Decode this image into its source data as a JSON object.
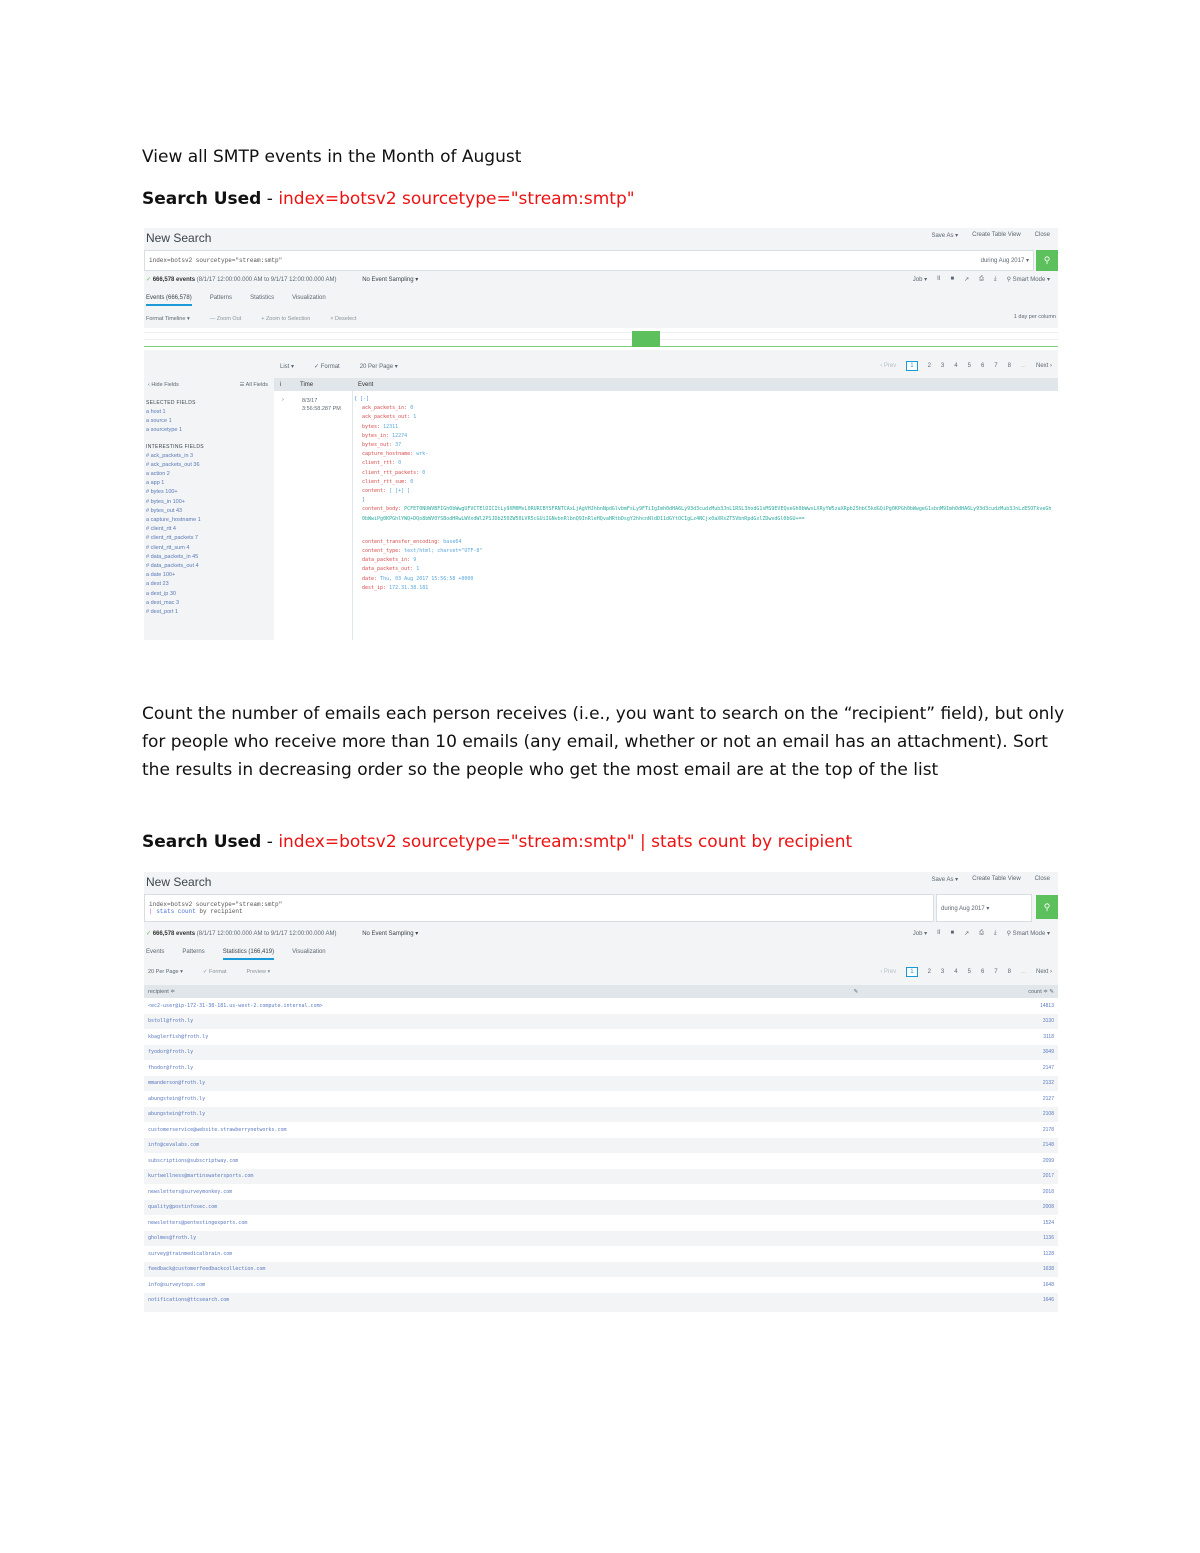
{
  "doc": {
    "heading1": "View all SMTP events in the Month of August",
    "search_label": "Search Used",
    "search_dash": " - ",
    "search1": "index=botsv2 sourcetype=\"stream:smtp\"",
    "paragraph2": "Count the number of emails each person receives (i.e., you want to search on the “recipient” field), but only for people who receive more than 10 emails (any email, whether or not an email has an attachment). Sort the results in decreasing order so the people who get the most email are at the top of the list",
    "search2": "index=botsv2 sourcetype=\"stream:smtp\" | stats count by recipient"
  },
  "panel1": {
    "title": "New Search",
    "actions": [
      "Save As ▾",
      "Create Table View",
      "Close"
    ],
    "query": "index=botsv2 sourcetype=\"stream:smtp\"",
    "time_picker": "during Aug 2017 ▾",
    "search_icon": "⚲",
    "status_check": "✓",
    "status_count": "666,578 events",
    "status_range": "(8/1/17 12:00:00.000 AM to 9/1/17 12:00:00.000 AM)",
    "sampling": "No Event Sampling ▾",
    "jobtools": [
      "Job ▾",
      "II",
      "■",
      "↗",
      "⎙",
      "⤓",
      "⚲ Smart Mode ▾"
    ],
    "tabs": [
      "Events (666,578)",
      "Patterns",
      "Statistics",
      "Visualization"
    ],
    "subtools": [
      "Format Timeline ▾",
      "— Zoom Out",
      "+ Zoom to Selection",
      "× Deselect"
    ],
    "timeline_scale": "1 day per column",
    "timeline_bar_values": [
      0,
      0,
      0,
      0,
      0,
      0,
      0,
      0,
      0,
      0,
      0,
      1,
      0,
      0,
      0,
      0,
      0,
      0,
      0,
      0,
      0,
      0
    ],
    "listtools": [
      "List ▾",
      "✓ Format",
      "20 Per Page ▾"
    ],
    "pager": {
      "prev": "‹ Prev",
      "pages": [
        "1",
        "2",
        "3",
        "4",
        "5",
        "6",
        "7",
        "8"
      ],
      "ellipsis": "...",
      "next": "Next ›"
    },
    "fields_sidebar": {
      "hide": "‹ Hide Fields",
      "all": "☰ All Fields",
      "selected_title": "SELECTED FIELDS",
      "selected": [
        "a host 1",
        "a source 1",
        "a sourcetype 1"
      ],
      "interesting_title": "INTERESTING FIELDS",
      "interesting": [
        "# ack_packets_in 3",
        "# ack_packets_out 36",
        "a action 2",
        "a app 1",
        "# bytes 100+",
        "# bytes_in 100+",
        "# bytes_out 43",
        "a capture_hostname 1",
        "# client_rtt 4",
        "# client_rtt_packets 7",
        "# client_rtt_sum 4",
        "# data_packets_in 45",
        "# data_packets_out 4",
        "a date 100+",
        "a dest 23",
        "a dest_ip 30",
        "a dest_mac 3",
        "# dest_port 1"
      ]
    },
    "events_header": {
      "i": "i",
      "time": "Time",
      "event": "Event"
    },
    "event": {
      "expand": "›",
      "time": [
        "8/3/17",
        "3:56:58.287 PM"
      ],
      "open": "{ [-]",
      "fields": [
        {
          "k": "ack_packets_in",
          "v": "0"
        },
        {
          "k": "ack_packets_out",
          "v": "1"
        },
        {
          "k": "bytes",
          "v": "12311"
        },
        {
          "k": "bytes_in",
          "v": "12274"
        },
        {
          "k": "bytes_out",
          "v": "37"
        },
        {
          "k": "capture_hostname",
          "v": "wrk-"
        },
        {
          "k": "client_rtt",
          "v": "0"
        },
        {
          "k": "client_rtt_packets",
          "v": "0"
        },
        {
          "k": "client_rtt_sum",
          "v": "0"
        },
        {
          "k": "content",
          "v": "[ [+] ]"
        }
      ],
      "close_mark": "]",
      "body_key": "content_body",
      "body_blob": "PCFET0NUWVBFIGh0bWwgUFVCTElDICItLy9XM0MvL0RURCBYSFRNTCAxLjAgVHJhbnNpdGlvbmFsLy9FTiIgImh0dHA6Ly93d3cudzMub3JnL1RSL3hodG1sMS9EVEQveGh0bWwxLXRyYW5zaXRpb25hbC5kdGQiPg0KPGh0bWwgeG1sbnM9Imh0dHA6Ly93d3cudzMub3JnLzE5OTkveGh0bWwiPg0KPGhlYWQ+DQo8bWV0YSBodHRwLWVxdWl2PSJDb250ZW50LVR5cGUiIGNvbnRlbnQ9InRleHQvaHRtbDsgY2hhcnNldD11dGYtOCIgLz4NCjx0aXRsZT5VbnRpdGxlZDwvdGl0bGU+==",
      "fields2": [
        {
          "k": "content_transfer_encoding",
          "v": "base64"
        },
        {
          "k": "content_type",
          "v": "text/html; charset=\"UTF-8\""
        },
        {
          "k": "data_packets_in",
          "v": "9"
        },
        {
          "k": "data_packets_out",
          "v": "1"
        },
        {
          "k": "date",
          "v": "Thu, 03 Aug 2017 15:56:58 +0000"
        },
        {
          "k": "dest_ip",
          "v": "172.31.38.181"
        }
      ]
    }
  },
  "panel2": {
    "title": "New Search",
    "actions": [
      "Save As ▾",
      "Create Table View",
      "Close"
    ],
    "query_line1": "index=botsv2 sourcetype=\"stream:smtp\"",
    "query_pipe": "| ",
    "query_cmd": "stats count",
    "query_rest": " by recipient",
    "time_picker": "during Aug 2017 ▾",
    "search_icon": "⚲",
    "status_check": "✓",
    "status_count": "666,578 events",
    "status_range": "(8/1/17 12:00:00.000 AM to 9/1/17 12:00:00.000 AM)",
    "sampling": "No Event Sampling ▾",
    "jobtools": [
      "Job ▾",
      "II",
      "■",
      "↗",
      "⎙",
      "⤓",
      "⚲ Smart Mode ▾"
    ],
    "tabs": [
      "Events",
      "Patterns",
      "Statistics (166,419)",
      "Visualization"
    ],
    "listtools": [
      "20 Per Page ▾",
      "✓ Format",
      "Preview ▾"
    ],
    "pager": {
      "prev": "‹ Prev",
      "pages": [
        "1",
        "2",
        "3",
        "4",
        "5",
        "6",
        "7",
        "8"
      ],
      "ellipsis": "...",
      "next": "Next ›"
    },
    "table": {
      "col_recipient": "recipient ≑",
      "col_recipient_edit": "✎",
      "col_count": "count ≑ ✎",
      "rows": [
        {
          "recipient": "<ec2-user@ip-172-31-38-181.us-west-2.compute.internal.com>",
          "count": "14813"
        },
        {
          "recipient": "bstoll@froth.ly",
          "count": "3130"
        },
        {
          "recipient": "kbaglerfish@froth.ly",
          "count": "3118"
        },
        {
          "recipient": "fyodor@froth.ly",
          "count": "3049"
        },
        {
          "recipient": "fhodor@froth.ly",
          "count": "2147"
        },
        {
          "recipient": "mmanderson@froth.ly",
          "count": "2132"
        },
        {
          "recipient": "abungstein@froth.ly",
          "count": "2127"
        },
        {
          "recipient": "abungstein@froth.ly",
          "count": "2108"
        },
        {
          "recipient": "customerservice@website.strawberrynetworks.com",
          "count": "2178"
        },
        {
          "recipient": "info@cevalabs.com",
          "count": "2148"
        },
        {
          "recipient": "subscriptions@subscriptway.com",
          "count": "2099"
        },
        {
          "recipient": "kurtwellness@martinswatersports.com",
          "count": "2017"
        },
        {
          "recipient": "newsletters@surveymonkey.com",
          "count": "2018"
        },
        {
          "recipient": "quality@postinfosec.com",
          "count": "2008"
        },
        {
          "recipient": "newsletters@pentestingexperts.com",
          "count": "1524"
        },
        {
          "recipient": "gholmes@froth.ly",
          "count": "1136"
        },
        {
          "recipient": "survey@trainmedicalbrain.com",
          "count": "1128"
        },
        {
          "recipient": "feedback@customerfeedbackcollection.com",
          "count": "1638"
        },
        {
          "recipient": "info@surveytops.com",
          "count": "1648"
        },
        {
          "recipient": "notifications@ttcsearch.com",
          "count": "1646"
        }
      ]
    }
  }
}
